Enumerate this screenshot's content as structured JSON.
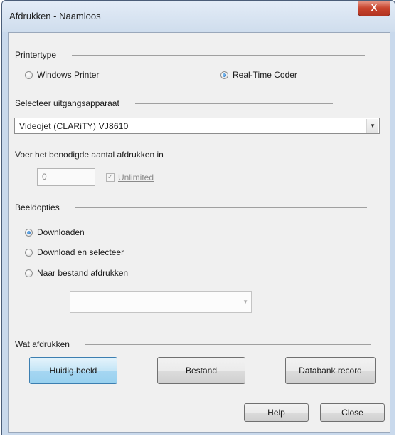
{
  "window": {
    "title": "Afdrukken - Naamloos",
    "close_glyph": "X"
  },
  "printer_type": {
    "label": "Printertype",
    "options": [
      {
        "label": "Windows Printer",
        "selected": false
      },
      {
        "label": "Real-Time Coder",
        "selected": true
      }
    ]
  },
  "output_device": {
    "label": "Selecteer uitgangsapparaat",
    "value": "Videojet (CLARiTY) VJ8610"
  },
  "print_count": {
    "label": "Voer het benodigde aantal afdrukken in",
    "value": "0",
    "unlimited_label": "Unlimited",
    "unlimited_checked": true,
    "disabled": true
  },
  "image_options": {
    "label": "Beeldopties",
    "options": [
      {
        "label": "Downloaden",
        "selected": true
      },
      {
        "label": "Download en selecteer",
        "selected": false
      },
      {
        "label": "Naar bestand afdrukken",
        "selected": false
      }
    ],
    "file_dropdown_value": ""
  },
  "what_to_print": {
    "label": "Wat afdrukken",
    "buttons": [
      {
        "label": "Huidig beeld",
        "active": true
      },
      {
        "label": "Bestand",
        "active": false
      },
      {
        "label": "Databank record",
        "active": false
      }
    ]
  },
  "footer": {
    "help_label": "Help",
    "close_label": "Close"
  },
  "colors": {
    "title_bar": "#cfdded",
    "close_button": "#c8442d",
    "radio_selected": "#1a5fb4",
    "active_button": "#c4e5f6"
  }
}
